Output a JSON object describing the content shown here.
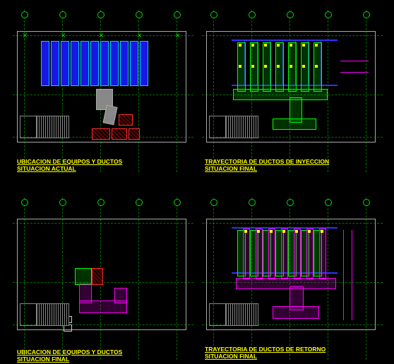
{
  "drawings": [
    {
      "id": "top-left",
      "title_line1": "UBICACION DE EQUIPOS Y DUCTOS",
      "title_line2": "SITUACION ACTUAL"
    },
    {
      "id": "top-right",
      "title_line1": "TRAYECTORIA DE DUCTOS DE INYECCION",
      "title_line2": "SITUACION FINAL"
    },
    {
      "id": "bottom-left",
      "title_line1": "UBICACION DE EQUIPOS Y DUCTOS",
      "title_line2": "SITUACION FINAL"
    },
    {
      "id": "bottom-right",
      "title_line1": "TRAYECTORIA DE DUCTOS DE RETORNO",
      "title_line2": "SITUACION FINAL"
    }
  ],
  "colors": {
    "rack": "#1818e6",
    "grid": "#00dd00",
    "duct_supply": "#00ff00",
    "duct_return": "#ff00ff",
    "equipment_new": "#ff3030",
    "caption": "#ffff00"
  }
}
